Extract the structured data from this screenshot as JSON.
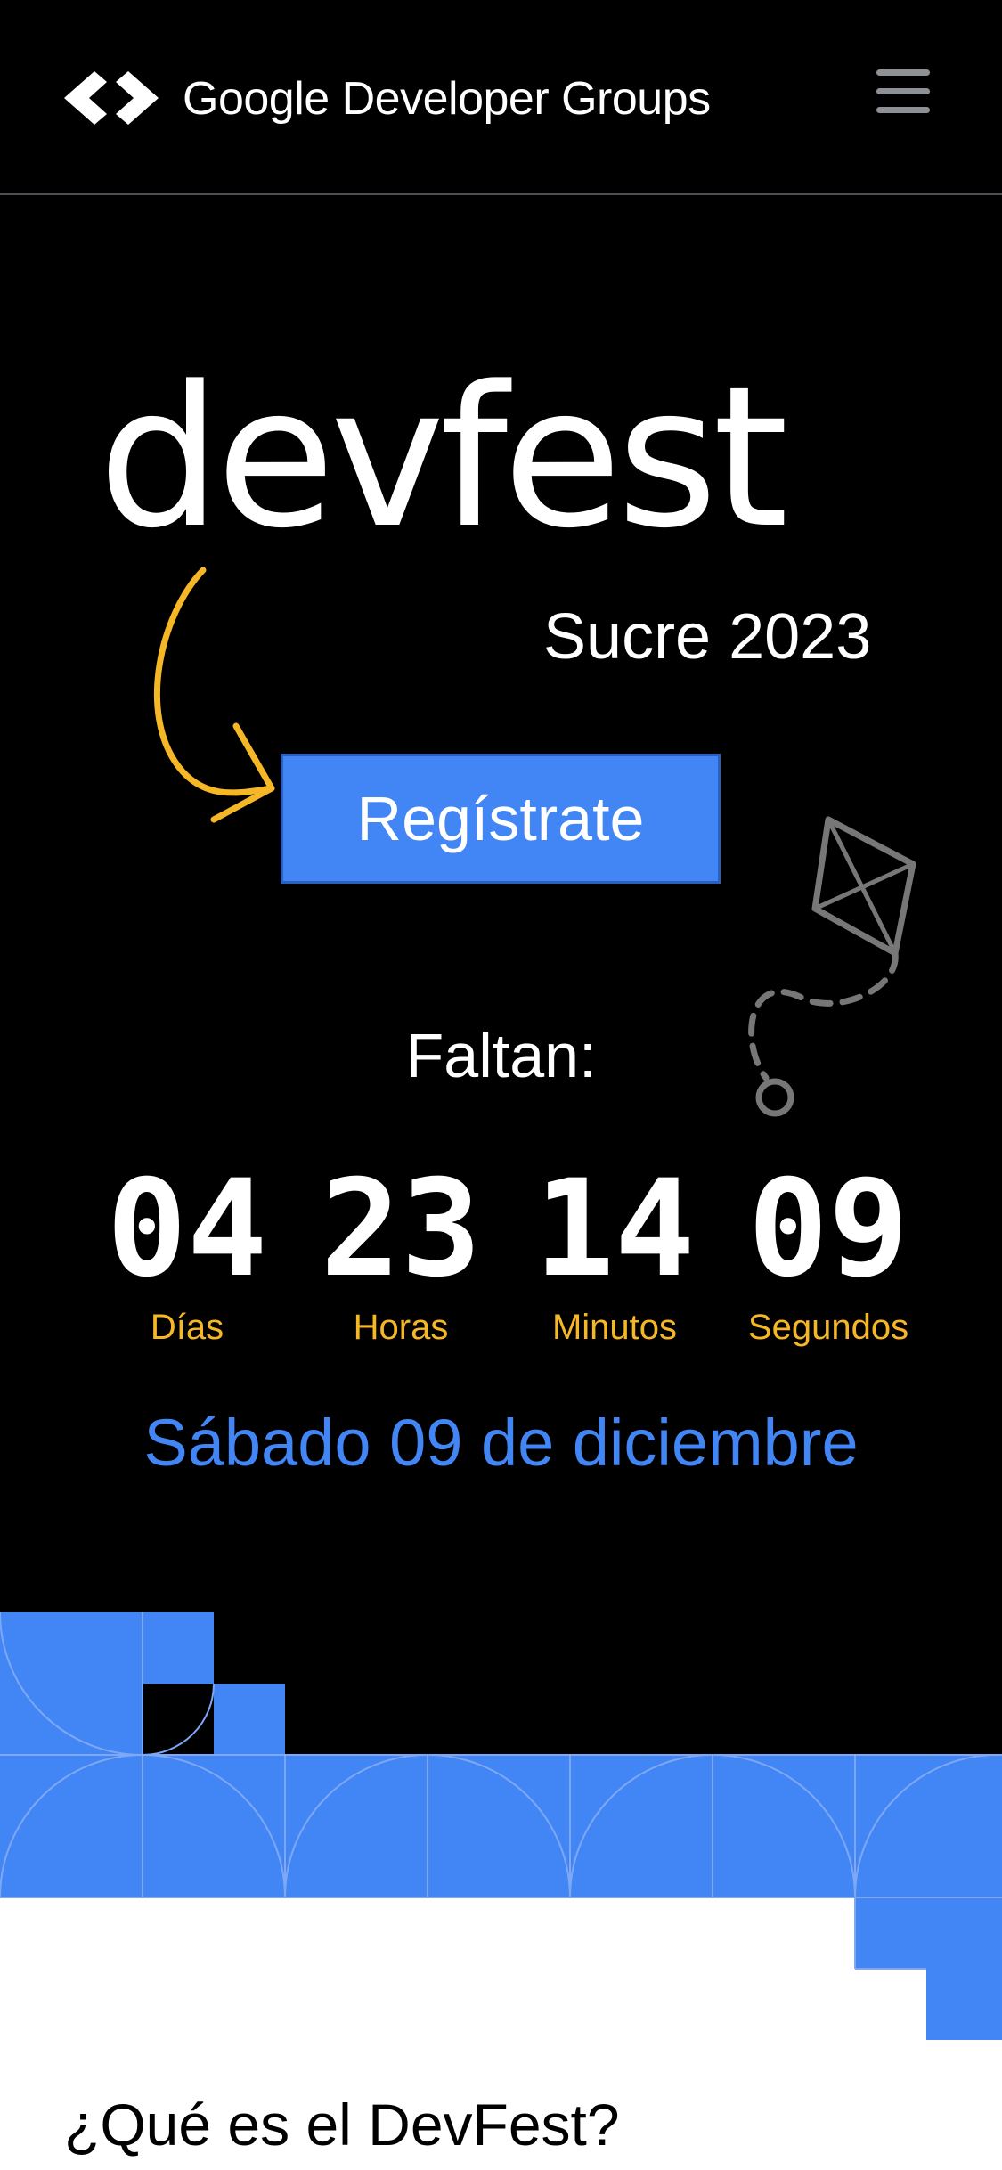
{
  "header": {
    "brand": "Google Developer Groups",
    "logo_icon": "gdg-logo-icon",
    "menu_icon": "hamburger-menu-icon"
  },
  "hero": {
    "title": "devfest",
    "subtitle": "Sucre 2023",
    "register_label": "Regístrate",
    "arrow_icon": "curved-arrow-icon",
    "kite_icon": "kite-icon"
  },
  "countdown": {
    "heading": "Faltan:",
    "days": {
      "value": "04",
      "label": "Días"
    },
    "hours": {
      "value": "23",
      "label": "Horas"
    },
    "minutes": {
      "value": "14",
      "label": "Minutos"
    },
    "seconds": {
      "value": "09",
      "label": "Segundos"
    }
  },
  "event_date": "Sábado 09 de diciembre",
  "about": {
    "title": "¿Qué es el DevFest?"
  },
  "colors": {
    "background": "#000000",
    "accent_blue": "#4285f4",
    "accent_yellow": "#f5b725",
    "text_white": "#ffffff"
  }
}
